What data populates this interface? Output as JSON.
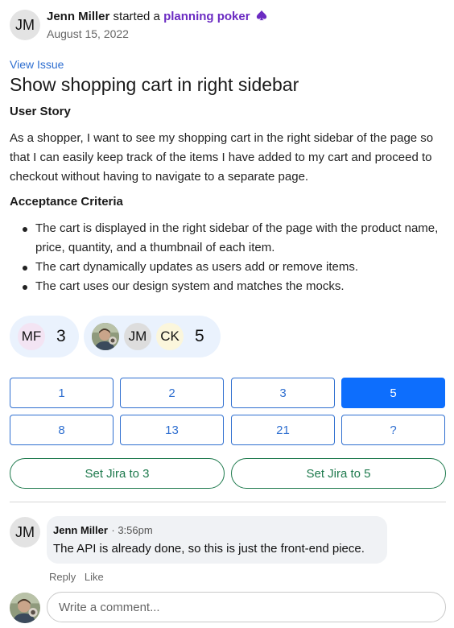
{
  "header": {
    "avatar_initials": "JM",
    "author": "Jenn Miller",
    "action": "started a",
    "activity": "planning poker",
    "activity_icon": "spade-icon",
    "date": "August 15, 2022"
  },
  "issue": {
    "view_link": "View Issue",
    "title": "Show shopping cart in right sidebar",
    "story_heading": "User Story",
    "story_text": "As a shopper, I want to see my shopping cart in the right sidebar of the page so that I can easily keep track of the items I have added to my cart and proceed to checkout without having to navigate to a separate page.",
    "criteria_heading": "Acceptance Criteria",
    "criteria": [
      "The cart is displayed in the right sidebar of the page with the product name, price, quantity, and a thumbnail of each item.",
      "The cart dynamically updates as users add or remove items.",
      "The cart uses our design system and matches the mocks."
    ]
  },
  "votes": {
    "group_a": {
      "voters": [
        "MF"
      ],
      "count": "3"
    },
    "group_b": {
      "voters": [
        "JM",
        "CK"
      ],
      "count": "5"
    }
  },
  "cards": [
    "1",
    "2",
    "3",
    "5",
    "8",
    "13",
    "21",
    "?"
  ],
  "selected_card": "5",
  "jira": {
    "button_a": "Set Jira to 3",
    "button_b": "Set Jira to 5"
  },
  "comment": {
    "avatar_initials": "JM",
    "author": "Jenn Miller",
    "time": "3:56pm",
    "text": "The API is already done, so this is just the front-end piece.",
    "reply_label": "Reply",
    "like_label": "Like"
  },
  "composer": {
    "placeholder": "Write a comment..."
  },
  "colors": {
    "accent_blue": "#2f6fd0",
    "selected_card": "#0d6efd",
    "jira_green": "#1e7a4d",
    "activity_purple": "#6b2bc2"
  }
}
